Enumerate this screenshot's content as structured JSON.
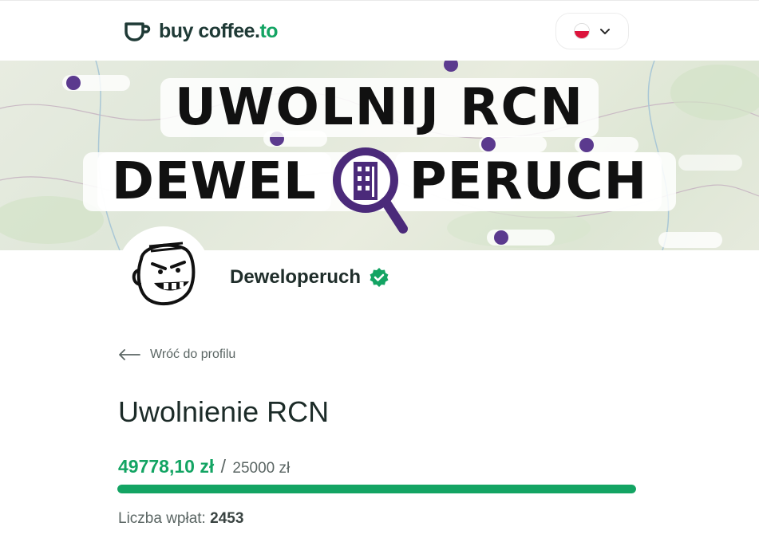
{
  "header": {
    "logo": {
      "part1": "buy coffee.",
      "part2": "to"
    },
    "language": {
      "flag": "pl-flag-icon",
      "chevron": "chevron-down-icon"
    }
  },
  "banner": {
    "line1": "UWOLNIJ RCN",
    "line2_left": "DEWEL",
    "line2_right": "PERUCH"
  },
  "profile": {
    "name": "Deweloperuch",
    "verified": true
  },
  "back": {
    "label": "Wróć do profilu"
  },
  "goal": {
    "title": "Uwolnienie RCN",
    "raised": "49778,10 zł",
    "separator": "/",
    "target": "25000 zł",
    "progress_fraction": 1.0,
    "count_label": "Liczba wpłat:",
    "count_value": "2453"
  },
  "colors": {
    "accent": "#13a463",
    "text": "#1f2d2a",
    "muted": "#5b6664"
  }
}
